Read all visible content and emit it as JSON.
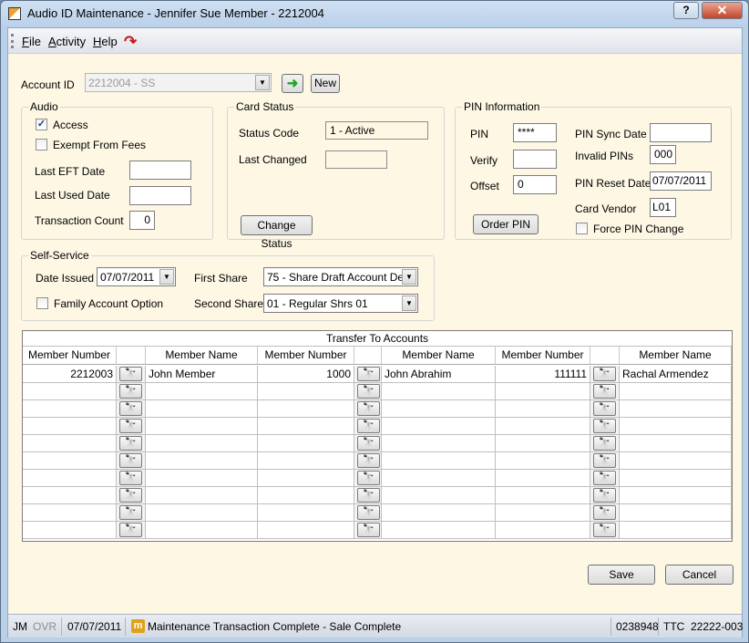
{
  "window": {
    "title": "Audio ID Maintenance - Jennifer Sue Member - 2212004",
    "help_label": "?",
    "close_label": "✕"
  },
  "menu": {
    "items": [
      {
        "label_u": "F",
        "label_rest": "ile"
      },
      {
        "label_u": "A",
        "label_rest": "ctivity"
      },
      {
        "label_u": "H",
        "label_rest": "elp"
      }
    ]
  },
  "account": {
    "label": "Account ID",
    "value": "2212004 - SS",
    "go_icon": "arrow-right-icon",
    "new_label": "New"
  },
  "audio": {
    "title": "Audio",
    "access_label": "Access",
    "access_checked": true,
    "exempt_label": "Exempt From Fees",
    "exempt_checked": false,
    "last_eft_label": "Last EFT Date",
    "last_eft_value": "",
    "last_used_label": "Last Used Date",
    "last_used_value": "",
    "txn_count_label": "Transaction Count",
    "txn_count_value": "0"
  },
  "card": {
    "title": "Card Status",
    "status_code_label": "Status Code",
    "status_code_value": "1 - Active",
    "last_changed_label": "Last Changed",
    "last_changed_value": "",
    "change_status_label": "Change Status"
  },
  "pin": {
    "title": "PIN Information",
    "pin_label": "PIN",
    "pin_value": "****",
    "verify_label": "Verify",
    "verify_value": "",
    "offset_label": "Offset",
    "offset_value": "0",
    "order_pin_label": "Order PIN",
    "sync_date_label": "PIN Sync Date",
    "sync_date_value": "",
    "invalid_label": "Invalid PINs",
    "invalid_value": "000",
    "reset_date_label": "PIN Reset Date",
    "reset_date_value": "07/07/2011",
    "vendor_label": "Card Vendor",
    "vendor_value": "L01",
    "force_label": "Force PIN Change",
    "force_checked": false
  },
  "self_service": {
    "title": "Self-Service",
    "date_issued_label": "Date Issued",
    "date_issued_value": "07/07/2011",
    "family_label": "Family Account Option",
    "family_checked": false,
    "first_share_label": "First Share",
    "first_share_value": "75 - Share Draft Account De",
    "second_share_label": "Second Share",
    "second_share_value": "01 - Regular Shrs 01"
  },
  "transfer": {
    "title": "Transfer To Accounts",
    "col_member_number": "Member Number",
    "col_member_name": "Member Name",
    "lookup_icon": "binoculars-icon",
    "rows": [
      [
        {
          "num": "2212003",
          "name": "John Member"
        },
        {
          "num": "1000",
          "name": "John Abrahim"
        },
        {
          "num": "111111",
          "name": "Rachal Armendez"
        }
      ],
      [
        {
          "num": "",
          "name": ""
        },
        {
          "num": "",
          "name": ""
        },
        {
          "num": "",
          "name": ""
        }
      ],
      [
        {
          "num": "",
          "name": ""
        },
        {
          "num": "",
          "name": ""
        },
        {
          "num": "",
          "name": ""
        }
      ],
      [
        {
          "num": "",
          "name": ""
        },
        {
          "num": "",
          "name": ""
        },
        {
          "num": "",
          "name": ""
        }
      ],
      [
        {
          "num": "",
          "name": ""
        },
        {
          "num": "",
          "name": ""
        },
        {
          "num": "",
          "name": ""
        }
      ],
      [
        {
          "num": "",
          "name": ""
        },
        {
          "num": "",
          "name": ""
        },
        {
          "num": "",
          "name": ""
        }
      ],
      [
        {
          "num": "",
          "name": ""
        },
        {
          "num": "",
          "name": ""
        },
        {
          "num": "",
          "name": ""
        }
      ],
      [
        {
          "num": "",
          "name": ""
        },
        {
          "num": "",
          "name": ""
        },
        {
          "num": "",
          "name": ""
        }
      ],
      [
        {
          "num": "",
          "name": ""
        },
        {
          "num": "",
          "name": ""
        },
        {
          "num": "",
          "name": ""
        }
      ],
      [
        {
          "num": "",
          "name": ""
        },
        {
          "num": "",
          "name": ""
        },
        {
          "num": "",
          "name": ""
        }
      ]
    ]
  },
  "actions": {
    "save_label": "Save",
    "cancel_label": "Cancel"
  },
  "status": {
    "user": "JM",
    "ovr": "OVR",
    "date": "07/07/2011",
    "icon_letter": "m",
    "message": "Maintenance Transaction Complete - Sale Complete",
    "code": "0238948",
    "ttc_label": "TTC",
    "ttc_value": "22222-003"
  }
}
